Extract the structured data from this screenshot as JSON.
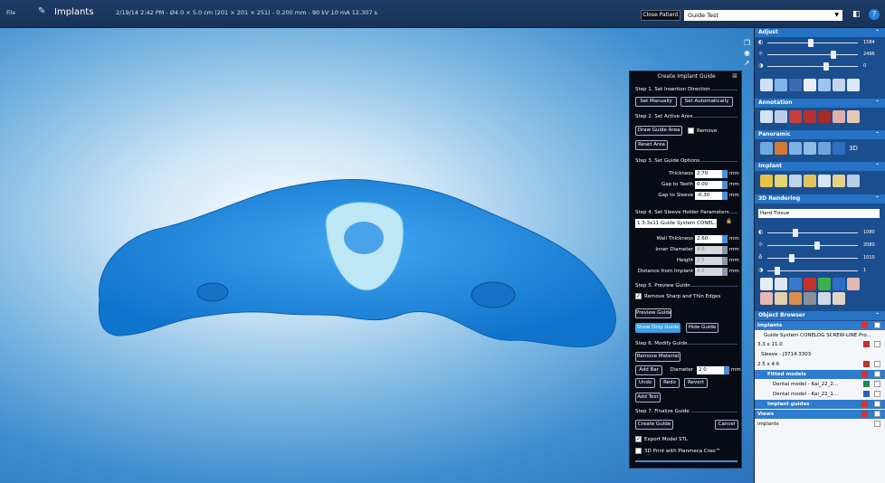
{
  "topbar": {
    "file_label": "File",
    "title": "Implants",
    "info": "2/19/14 2:42 PM - Ø4.0 × 5.0 cm (201 × 201 × 251) - 0.200 mm - 90 kV 10 mA 12.307 s",
    "close_patient": "Close Patient",
    "guide_select": "Guide Test"
  },
  "guide_panel": {
    "title": "Create Implant Guide",
    "step1": "Step 1. Set Insertion Direction",
    "set_manually": "Set Manually",
    "set_automatically": "Set Automatically",
    "step2": "Step 2. Set Active Area",
    "draw_guide_area": "Draw Guide Area",
    "remove": "Remove",
    "reset_area": "Reset Area",
    "step3": "Step 3. Set Guide Options",
    "thickness_label": "Thickness",
    "thickness": "2.70",
    "gap_teeth_label": "Gap to Teeth",
    "gap_teeth": "0.00",
    "gap_sleeve_label": "Gap to Sleeve",
    "gap_sleeve": "-0.30",
    "unit": "mm",
    "step4": "Step 4. Set Sleeve Holder Parameters",
    "sleeve_select": "1 3.3x11 Guide System CONEL...",
    "wall_thickness_label": "Wall Thickness",
    "wall_thickness": "2.60",
    "inner_diameter_label": "Inner Diameter",
    "inner_diameter": "4.6",
    "height_label": "Height",
    "height": "2.5",
    "distance_label": "Distance from Implant",
    "distance": "4.5",
    "step5": "Step 5. Preview Guide",
    "remove_sharp": "Remove Sharp and Thin Edges",
    "preview_guide": "Preview Guide",
    "show_only_guide": "Show Only Guide",
    "hide_guide": "Hide Guide",
    "step6": "Step 6. Modify Guide",
    "remove_material": "Remove Material",
    "add_bar": "Add Bar",
    "diameter_label": "Diameter",
    "diameter": "2.0",
    "undo": "Undo",
    "redo": "Redo",
    "revert": "Revert",
    "add_text": "Add Text",
    "step7": "Step 7. Finalize Guide",
    "create_guide": "Create Guide",
    "cancel": "Cancel",
    "export_stl": "Export Model STL",
    "print_3d": "3D Print with Planmeca Creo™"
  },
  "right_panel": {
    "adjust": "Adjust",
    "adjust_values": [
      "1584",
      "2496",
      "0"
    ],
    "annotation": "Annotation",
    "panoramic": "Panoramic",
    "implant": "Implant",
    "rendering": "3D Rendering",
    "render_mode": "Hard Tissue",
    "render_values": [
      "1080",
      "2080",
      "1010",
      "1"
    ],
    "object_browser": "Object Browser",
    "implants_hdr": "Implants",
    "implant_item": "Guide System CONELOG SCREW-LINE Pro...",
    "size1": "3.3 x 11.0",
    "sleeve": "Sleeve - J3714.3303",
    "size2": "2.5 x 4.6",
    "fitted_hdr": "Fitted models",
    "fitted1": "Dental model - Kai_22_2...",
    "fitted2": "Dental model - Kai_22_1...",
    "guides_hdr": "Implant guides",
    "views_hdr": "Views",
    "views_item": "implants",
    "threed": "3D"
  }
}
